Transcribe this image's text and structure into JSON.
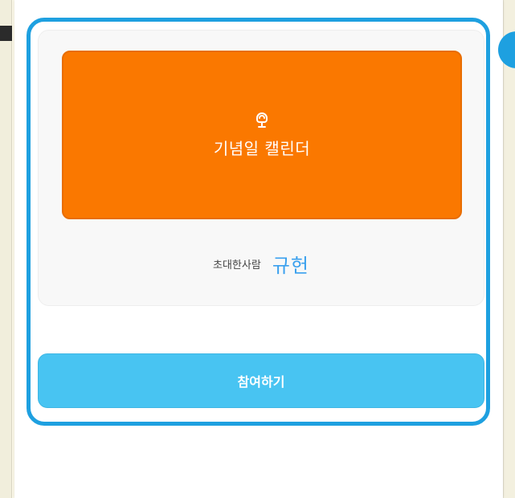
{
  "invitation": {
    "event_name": "기념일 캘린더",
    "event_icon": "shell-chair-icon",
    "inviter_label": "초대한사람",
    "inviter_name": "규헌",
    "join_label": "참여하기"
  },
  "colors": {
    "banner": "#fa7800",
    "join_button": "#48c4f2",
    "inviter_name": "#3aa0ee",
    "highlight": "#1ea0e0"
  }
}
